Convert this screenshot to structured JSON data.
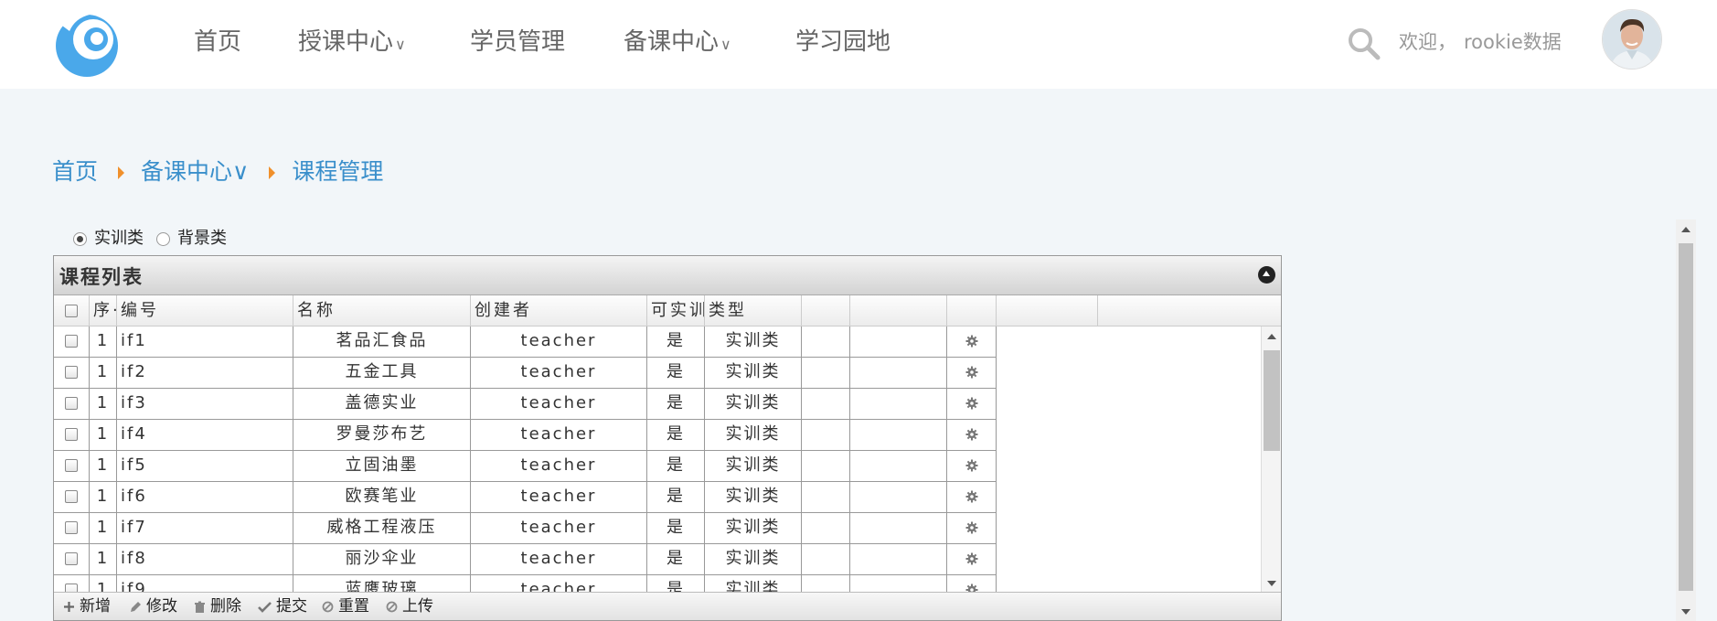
{
  "nav": {
    "items": [
      {
        "label": "首页",
        "dropdown": false
      },
      {
        "label": "授课中心",
        "dropdown": true
      },
      {
        "label": "学员管理",
        "dropdown": false
      },
      {
        "label": "备课中心",
        "dropdown": true
      },
      {
        "label": "学习园地",
        "dropdown": false
      }
    ],
    "dropdown_glyph": "∨",
    "welcome": "欢迎，",
    "username": "rookie数据",
    "icons": [
      "logo-icon",
      "search-icon",
      "avatar"
    ]
  },
  "breadcrumb": [
    {
      "label": "首页"
    },
    {
      "label": "备课中心∨"
    },
    {
      "label": "课程管理"
    }
  ],
  "filter": {
    "options": [
      {
        "label": "实训类",
        "checked": true
      },
      {
        "label": "背景类",
        "checked": false
      }
    ]
  },
  "grid": {
    "title": "课程列表",
    "columns": [
      "序·",
      "编号",
      "名称",
      "创建者",
      "可实训",
      "类型",
      "",
      "",
      "",
      ""
    ],
    "rows": [
      {
        "seq": "1",
        "code": "if1",
        "name": "茗品汇食品",
        "creator": "teacher",
        "trainable": "是",
        "type": "实训类"
      },
      {
        "seq": "1",
        "code": "if2",
        "name": "五金工具",
        "creator": "teacher",
        "trainable": "是",
        "type": "实训类"
      },
      {
        "seq": "1",
        "code": "if3",
        "name": "盖德实业",
        "creator": "teacher",
        "trainable": "是",
        "type": "实训类"
      },
      {
        "seq": "1",
        "code": "if4",
        "name": "罗曼莎布艺",
        "creator": "teacher",
        "trainable": "是",
        "type": "实训类"
      },
      {
        "seq": "1",
        "code": "if5",
        "name": "立固油墨",
        "creator": "teacher",
        "trainable": "是",
        "type": "实训类"
      },
      {
        "seq": "1",
        "code": "if6",
        "name": "欧赛笔业",
        "creator": "teacher",
        "trainable": "是",
        "type": "实训类"
      },
      {
        "seq": "1",
        "code": "if7",
        "name": "威格工程液压",
        "creator": "teacher",
        "trainable": "是",
        "type": "实训类"
      },
      {
        "seq": "1",
        "code": "if8",
        "name": "丽沙伞业",
        "creator": "teacher",
        "trainable": "是",
        "type": "实训类"
      },
      {
        "seq": "1",
        "code": "if9",
        "name": "蓝鹰玻璃",
        "creator": "teacher",
        "trainable": "是",
        "type": "实训类"
      }
    ],
    "toolbar": [
      {
        "label": "新增",
        "icon": "plus-icon"
      },
      {
        "label": "修改",
        "icon": "pencil-icon"
      },
      {
        "label": "删除",
        "icon": "trash-icon"
      },
      {
        "label": "提交",
        "icon": "check-icon"
      },
      {
        "label": "重置",
        "icon": "reset-icon"
      },
      {
        "label": "上传",
        "icon": "upload-icon"
      }
    ]
  },
  "colors": {
    "link_blue": "#3a8fcb",
    "breadcrumb_arrow": "#f0902c",
    "logo_blue": "#4aa8ea",
    "page_bg": "#f2f6f9"
  }
}
